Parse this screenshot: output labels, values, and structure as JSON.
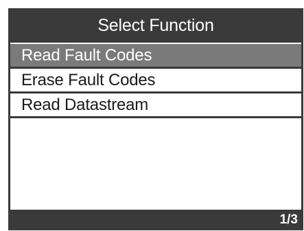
{
  "header": {
    "title": "Select Function"
  },
  "menu": {
    "items": [
      {
        "label": "Read Fault Codes",
        "selected": true
      },
      {
        "label": "Erase Fault Codes",
        "selected": false
      },
      {
        "label": "Read Datastream",
        "selected": false
      }
    ]
  },
  "footer": {
    "page_indicator": "1/3"
  },
  "colors": {
    "bar_background": "#3a3a3a",
    "selected_background": "#7a7a7a",
    "screen_background": "#ffffff"
  }
}
